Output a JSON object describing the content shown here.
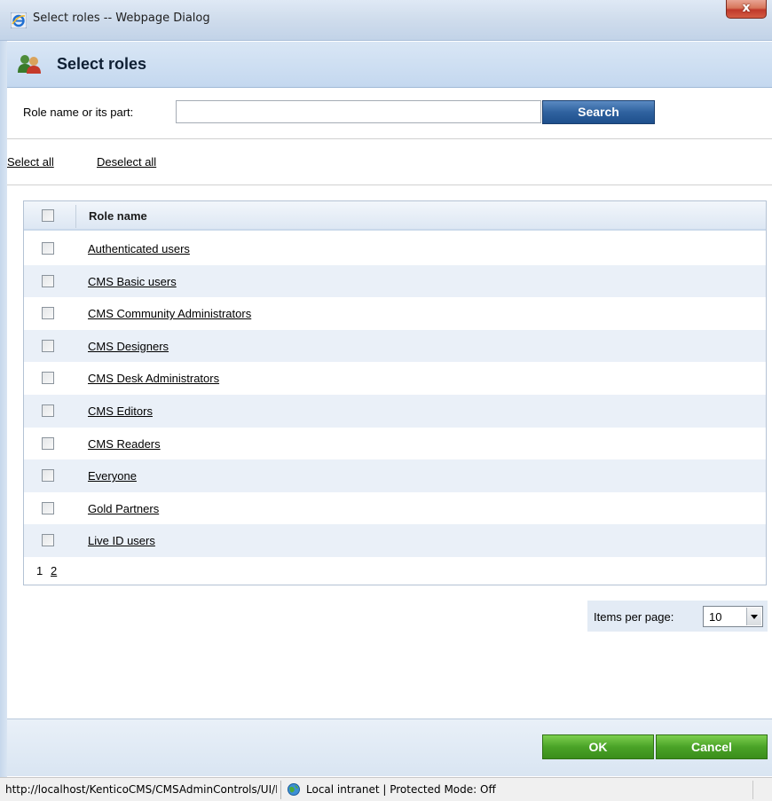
{
  "window": {
    "title": "Select roles -- Webpage Dialog",
    "close_glyph": "x"
  },
  "dialog": {
    "title": "Select roles",
    "icon": "roles-icon"
  },
  "filter": {
    "label": "Role name or its part:",
    "value": "",
    "search_label": "Search"
  },
  "selection": {
    "select_all": "Select all",
    "deselect_all": "Deselect all"
  },
  "grid": {
    "header": "Role name",
    "rows": [
      {
        "name": "Authenticated users",
        "checked": false
      },
      {
        "name": "CMS Basic users",
        "checked": false
      },
      {
        "name": "CMS Community Administrators",
        "checked": false
      },
      {
        "name": "CMS Designers",
        "checked": false
      },
      {
        "name": "CMS Desk Administrators",
        "checked": false
      },
      {
        "name": "CMS Editors",
        "checked": false
      },
      {
        "name": "CMS Readers",
        "checked": false
      },
      {
        "name": "Everyone",
        "checked": false
      },
      {
        "name": "Gold Partners",
        "checked": false
      },
      {
        "name": "Live ID users",
        "checked": false
      }
    ],
    "pager": {
      "current": "1",
      "next": "2"
    }
  },
  "items_per_page": {
    "label": "Items per page:",
    "value": "10"
  },
  "footer": {
    "ok_label": "OK",
    "cancel_label": "Cancel"
  },
  "statusbar": {
    "url": "http://localhost/KenticoCMS/CMSAdminControls/UI/Dialogs/SelectRole.aspx",
    "zone": "Local intranet | Protected Mode: Off"
  },
  "colors": {
    "header_bg": "#c4d8ef",
    "search_button": "#2f629f",
    "ok_button": "#4aa327",
    "alt_row": "#eaf0f8"
  }
}
